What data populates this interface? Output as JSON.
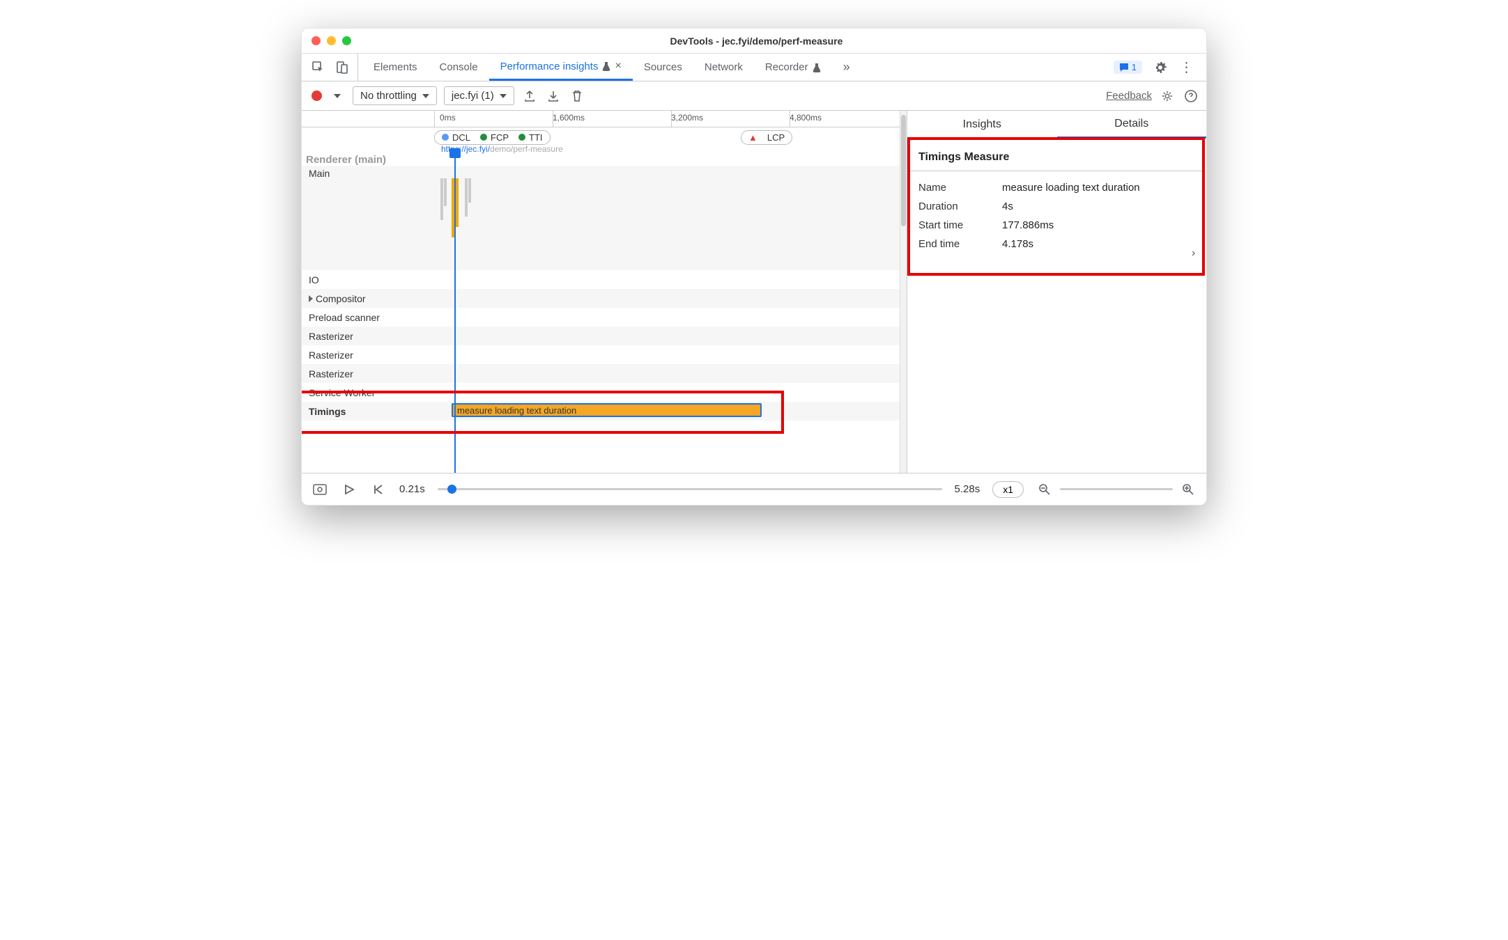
{
  "window": {
    "title": "DevTools - jec.fyi/demo/perf-measure"
  },
  "tabs": {
    "elements": "Elements",
    "console": "Console",
    "perf": "Performance insights",
    "sources": "Sources",
    "network": "Network",
    "recorder": "Recorder",
    "issues_count": "1"
  },
  "toolbar": {
    "throttle": "No throttling",
    "page": "jec.fyi (1)",
    "feedback": "Feedback"
  },
  "ruler": {
    "t0": "0ms",
    "t1": "1,600ms",
    "t2": "3,200ms",
    "t3": "4,800ms"
  },
  "markers": {
    "dcl": "DCL",
    "fcp": "FCP",
    "tti": "TTI",
    "lcp": "LCP"
  },
  "url": {
    "scheme": "https://jec.fyi/",
    "path": "demo/perf-measure"
  },
  "tracks": {
    "renderer": "Renderer (main)",
    "main": "Main",
    "io": "IO",
    "compositor": "Compositor",
    "preload": "Preload scanner",
    "raster1": "Rasterizer",
    "raster2": "Rasterizer",
    "raster3": "Rasterizer",
    "sw": "Service Worker",
    "timings": "Timings",
    "measure_label": "measure loading text duration"
  },
  "right": {
    "insights": "Insights",
    "details": "Details",
    "title": "Timings Measure",
    "rows": {
      "name_k": "Name",
      "name_v": "measure loading text duration",
      "dur_k": "Duration",
      "dur_v": "4s",
      "start_k": "Start time",
      "start_v": "177.886ms",
      "end_k": "End time",
      "end_v": "4.178s"
    }
  },
  "footer": {
    "start": "0.21s",
    "end": "5.28s",
    "speed": "x1"
  }
}
